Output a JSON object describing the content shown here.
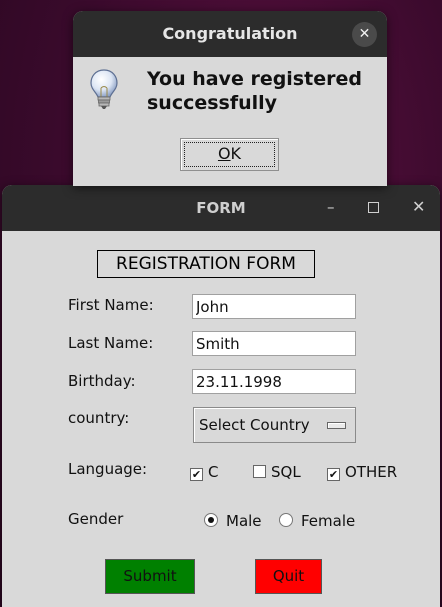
{
  "dialog": {
    "title": "Congratulation",
    "close_label": "✕",
    "message_line1": "You have registered",
    "message_line2": "successfully",
    "ok_label_underlined": "O",
    "ok_label_rest": "K"
  },
  "form_window": {
    "title": "FORM",
    "minimize_label": "–",
    "close_label": "✕"
  },
  "form": {
    "heading": "REGISTRATION FORM",
    "first_name_label": "First Name:",
    "first_name_value": "John",
    "last_name_label": "Last Name:",
    "last_name_value": "Smith",
    "birthday_label": "Birthday:",
    "birthday_value": "23.11.1998",
    "country_label": "country:",
    "country_value": "Select Country",
    "language_label": "Language:",
    "languages": [
      {
        "label": "C",
        "checked": true
      },
      {
        "label": "SQL",
        "checked": false
      },
      {
        "label": "OTHER",
        "checked": true
      }
    ],
    "gender_label": "Gender",
    "genders": [
      {
        "label": "Male",
        "selected": true
      },
      {
        "label": "Female",
        "selected": false
      }
    ],
    "submit_label": "Submit",
    "quit_label": "Quit"
  },
  "colors": {
    "submit": "#008000",
    "quit": "#ff0000",
    "titlebar": "#2c2c2c",
    "window_bg": "#d9d9d9"
  },
  "icons": {
    "dialog": "lightbulb-icon",
    "checkmark": "checkmark-icon"
  }
}
